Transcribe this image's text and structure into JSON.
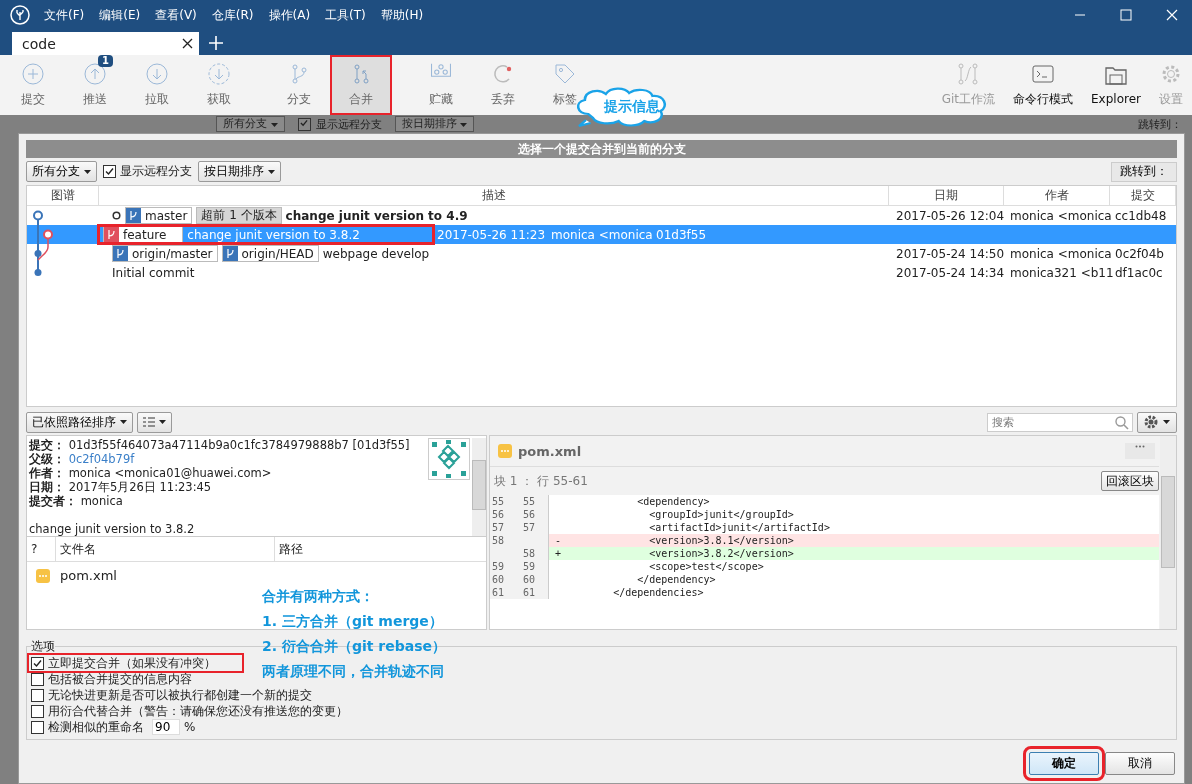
{
  "menu": [
    "文件(F)",
    "编辑(E)",
    "查看(V)",
    "仓库(R)",
    "操作(A)",
    "工具(T)",
    "帮助(H)"
  ],
  "tabs": [
    {
      "label": "code",
      "selected": true
    }
  ],
  "toolbar": {
    "items": [
      {
        "kind": "commit",
        "label": "提交",
        "selected": false,
        "annotated": false
      },
      {
        "kind": "push",
        "label": "推送",
        "badge": "1",
        "selected": false,
        "annotated": false
      },
      {
        "kind": "pull",
        "label": "拉取",
        "selected": false,
        "annotated": false
      },
      {
        "kind": "fetch",
        "label": "获取",
        "selected": false,
        "annotated": false
      },
      {
        "kind": "branch",
        "label": "分支",
        "selected": false,
        "annotated": false
      },
      {
        "kind": "merge",
        "label": "合并",
        "selected": true,
        "annotated": true
      },
      {
        "kind": "stash",
        "label": "贮藏",
        "selected": false,
        "annotated": false
      },
      {
        "kind": "discard",
        "label": "丢弃",
        "selected": false,
        "annotated": false
      },
      {
        "kind": "tag",
        "label": "标签",
        "selected": false,
        "annotated": false
      }
    ],
    "right_items": [
      {
        "kind": "flow",
        "label": "Git工作流",
        "disabled": true
      },
      {
        "kind": "terminal",
        "label": "命令行模式",
        "disabled": false
      },
      {
        "kind": "folder",
        "label": "Explorer",
        "disabled": false
      },
      {
        "kind": "settings",
        "label": "设置",
        "disabled": true
      }
    ]
  },
  "callout": {
    "text": "提示信息"
  },
  "background_filters": {
    "branches": "所有分支",
    "show_remote": {
      "label": "显示远程分支",
      "checked": true
    },
    "sort": "按日期排序",
    "jump": "跳转到："
  },
  "dialog": {
    "title": "选择一个提交合并到当前的分支",
    "filters": {
      "branches": "所有分支",
      "show_remote": {
        "label": "显示远程分支",
        "checked": true
      },
      "sort": "按日期排序",
      "jump": "跳转到："
    },
    "commit_table": {
      "columns": [
        "图谱",
        "描述",
        "日期",
        "作者",
        "提交"
      ],
      "rows": [
        {
          "head": true,
          "selected": false,
          "annotated": false,
          "refs": [
            {
              "kind": "branch",
              "name": "master",
              "color": "#3a74b8"
            },
            {
              "kind": "ahead",
              "name": "超前 1 个版本"
            }
          ],
          "description": "change junit version to 4.9",
          "date": "2017-05-26 12:04",
          "author": "monica <monica",
          "commit": "cc1db48"
        },
        {
          "head": false,
          "selected": true,
          "annotated": true,
          "refs": [
            {
              "kind": "branch",
              "name": "feature",
              "color": "#e0505e"
            }
          ],
          "description": "change junit version to 3.8.2",
          "date": "2017-05-26 11:23",
          "author": "monica <monica",
          "commit": "01d3f55"
        },
        {
          "head": false,
          "selected": false,
          "annotated": false,
          "refs": [
            {
              "kind": "branch",
              "name": "origin/master",
              "color": "#3a74b8"
            },
            {
              "kind": "branch",
              "name": "origin/HEAD",
              "color": "#3a74b8"
            }
          ],
          "description": "webpage develop",
          "date": "2017-05-24 14:50",
          "author": "monica <monica",
          "commit": "0c2f04b"
        },
        {
          "head": false,
          "selected": false,
          "annotated": false,
          "refs": [],
          "description": "Initial commit",
          "date": "2017-05-24 14:34",
          "author": "monica321 <b11",
          "commit": "df1ac0c"
        }
      ]
    },
    "file_sort": "已依照路径排序",
    "search": {
      "placeholder": "搜索"
    },
    "details": {
      "fields": [
        {
          "kind": "text",
          "label": "提交：",
          "value": "01d3f55f464073a47114b9a0c1fc3784979888b7 [01d3f55]"
        },
        {
          "kind": "link",
          "label": "父级：",
          "value": "0c2f04b79f"
        },
        {
          "kind": "text",
          "label": "作者：",
          "value": "monica <monica01@huawei.com>"
        },
        {
          "kind": "text",
          "label": "日期：",
          "value": "2017年5月26日 11:23:45"
        },
        {
          "kind": "text",
          "label": "提交者：",
          "value": "monica"
        }
      ],
      "message": "change junit version to 3.8.2"
    },
    "files": {
      "columns": [
        "?",
        "文件名",
        "路径"
      ],
      "rows": [
        {
          "name": "pom.xml"
        }
      ]
    },
    "diff": {
      "file": "pom.xml",
      "hunk": "块 1 ： 行 55-61",
      "revert": "回滚区块",
      "lines": [
        {
          "kind": "context",
          "old": "55",
          "new": "55",
          "text": "            <dependency>"
        },
        {
          "kind": "context",
          "old": "56",
          "new": "56",
          "text": "              <groupId>junit</groupId>"
        },
        {
          "kind": "context",
          "old": "57",
          "new": "57",
          "text": "              <artifactId>junit</artifactId>"
        },
        {
          "kind": "removed",
          "old": "58",
          "sign": "-",
          "text": "              <version>3.8.1</version>"
        },
        {
          "kind": "added",
          "new": "58",
          "sign": "+",
          "text": "              <version>3.8.2</version>"
        },
        {
          "kind": "context",
          "old": "59",
          "new": "59",
          "text": "              <scope>test</scope>"
        },
        {
          "kind": "context",
          "old": "60",
          "new": "60",
          "text": "            </dependency>"
        },
        {
          "kind": "context",
          "old": "61",
          "new": "61",
          "text": "        </dependencies>"
        }
      ]
    },
    "options": {
      "title": "选项",
      "items": [
        {
          "kind": "checkbox",
          "label": "立即提交合并（如果没有冲突）",
          "checked": true,
          "annotated": true
        },
        {
          "kind": "checkbox",
          "label": "包括被合并提交的信息内容",
          "checked": false,
          "annotated": false
        },
        {
          "kind": "checkbox",
          "label": "无论快进更新是否可以被执行都创建一个新的提交",
          "checked": false,
          "annotated": false
        },
        {
          "kind": "checkbox",
          "label": "用衍合代替合并（警告：请确保您还没有推送您的变更）",
          "checked": false,
          "annotated": false
        },
        {
          "kind": "checkbox-number",
          "label": "检测相似的重命名",
          "checked": false,
          "annotated": false,
          "value": "90",
          "suffix": "%"
        }
      ]
    },
    "buttons": [
      {
        "label": "确定",
        "default": true,
        "annotated": true
      },
      {
        "label": "取消",
        "default": false,
        "annotated": false
      }
    ]
  },
  "annotation": {
    "lines": [
      "合并有两种方式：",
      "1. 三方合并（git merge）",
      "2. 衍合合并（git rebase）",
      "两者原理不同，合并轨迹不同"
    ]
  }
}
